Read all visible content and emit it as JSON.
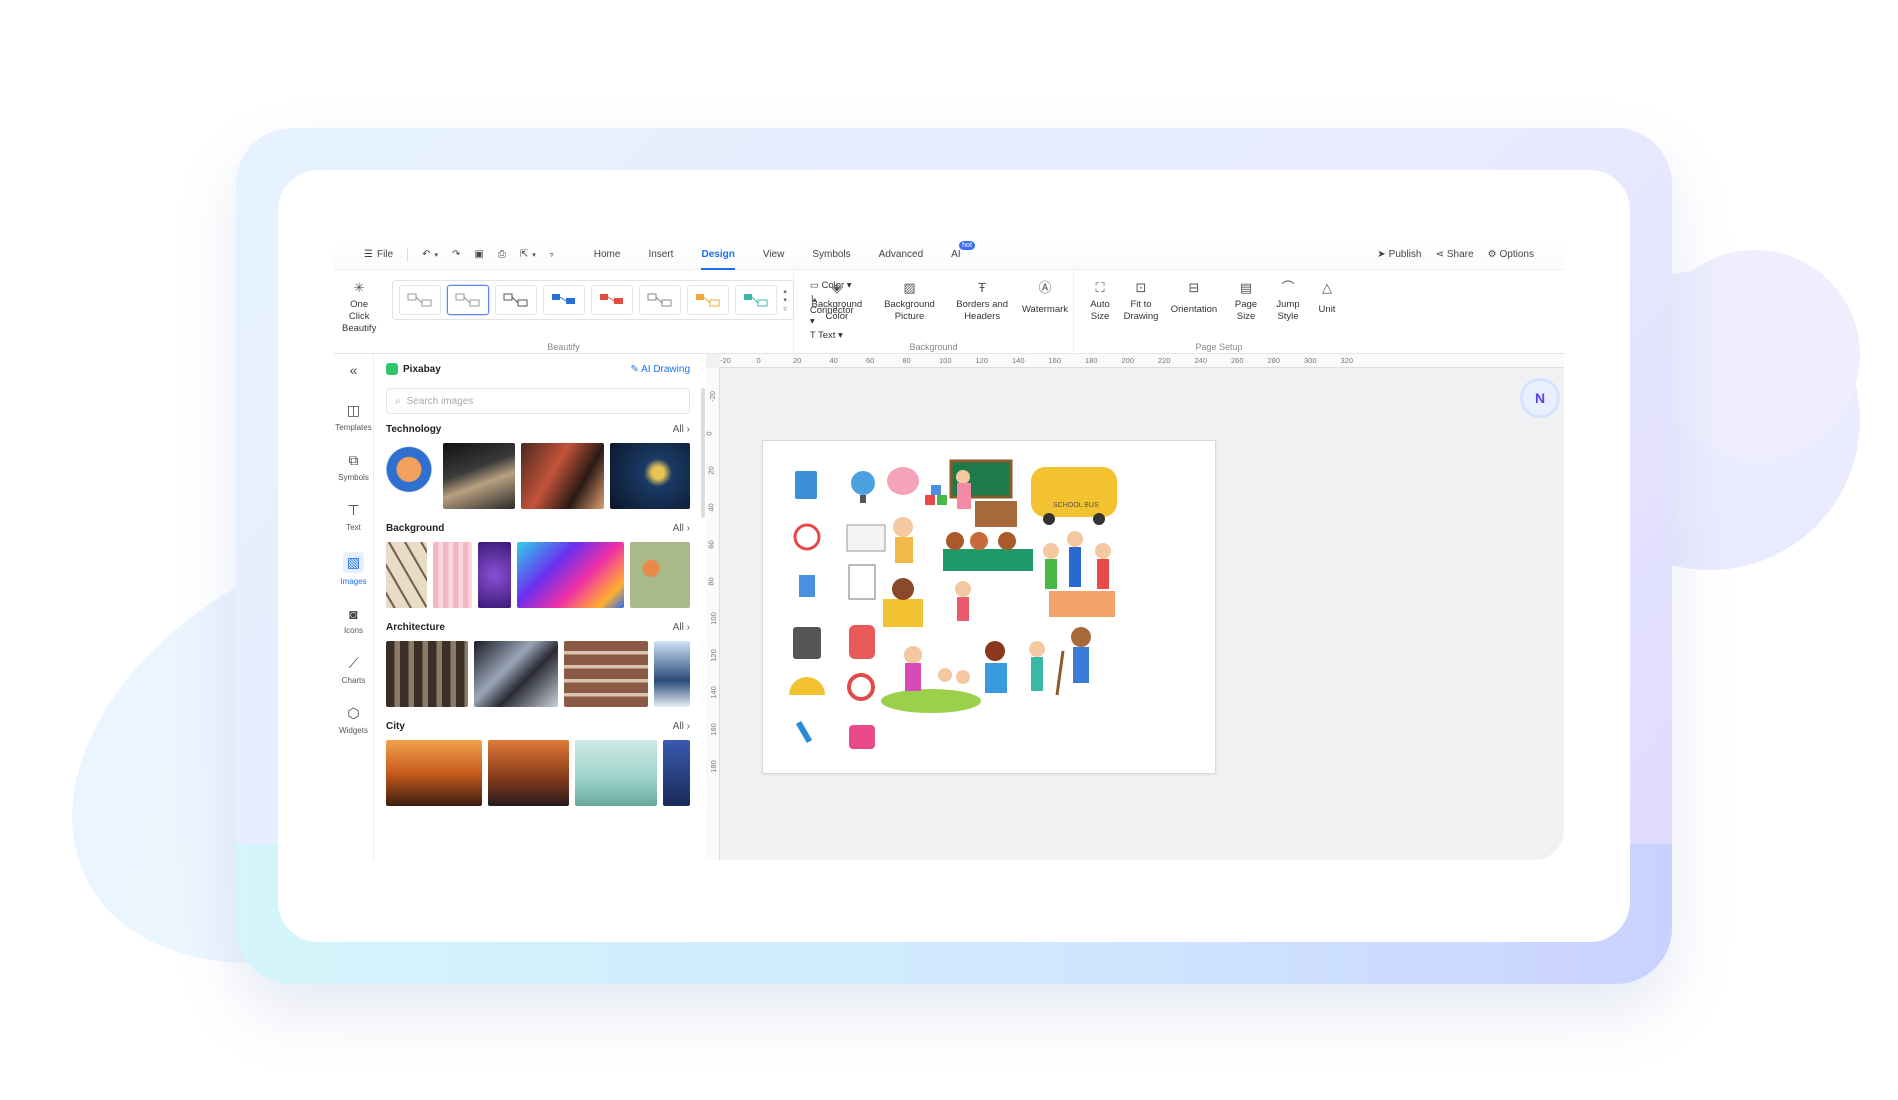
{
  "topbar": {
    "file_label": "File",
    "tabs": [
      "Home",
      "Insert",
      "Design",
      "View",
      "Symbols",
      "Advanced",
      "AI"
    ],
    "active_tab": "Design",
    "hot_badge": "hot",
    "right": {
      "publish": "Publish",
      "share": "Share",
      "options": "Options"
    }
  },
  "ribbon": {
    "one_click_beautify": "One Click Beautify",
    "beautify_group": "Beautify",
    "color": "Color",
    "connector": "Connector",
    "text": "Text",
    "background_color": "Background Color",
    "background_picture": "Background Picture",
    "borders_headers": "Borders and Headers",
    "watermark": "Watermark",
    "background_group": "Background",
    "auto_size": "Auto Size",
    "fit_to_drawing": "Fit to Drawing",
    "orientation": "Orientation",
    "page_size": "Page Size",
    "jump_style": "Jump Style",
    "unit": "Unit",
    "page_setup_group": "Page Setup"
  },
  "rail": {
    "items": [
      "Templates",
      "Symbols",
      "Text",
      "Images",
      "Icons",
      "Charts",
      "Widgets"
    ],
    "active": "Images"
  },
  "panel": {
    "source": "Pixabay",
    "ai_drawing": "AI Drawing",
    "search_placeholder": "Search images",
    "all_label": "All",
    "sections": [
      "Technology",
      "Background",
      "Architecture",
      "City"
    ]
  },
  "ruler": {
    "h": [
      "-20",
      "0",
      "20",
      "40",
      "60",
      "80",
      "100",
      "120",
      "140",
      "160",
      "180",
      "200",
      "220",
      "240",
      "260",
      "280",
      "300",
      "320"
    ],
    "v": [
      "-20",
      "0",
      "20",
      "40",
      "60",
      "80",
      "100",
      "120",
      "140",
      "160",
      "180"
    ]
  },
  "canvas": {
    "bus_text": "SCHOOL BUS"
  },
  "colors": {
    "accent": "#1b6ff0",
    "hot": "#3b6df6"
  }
}
